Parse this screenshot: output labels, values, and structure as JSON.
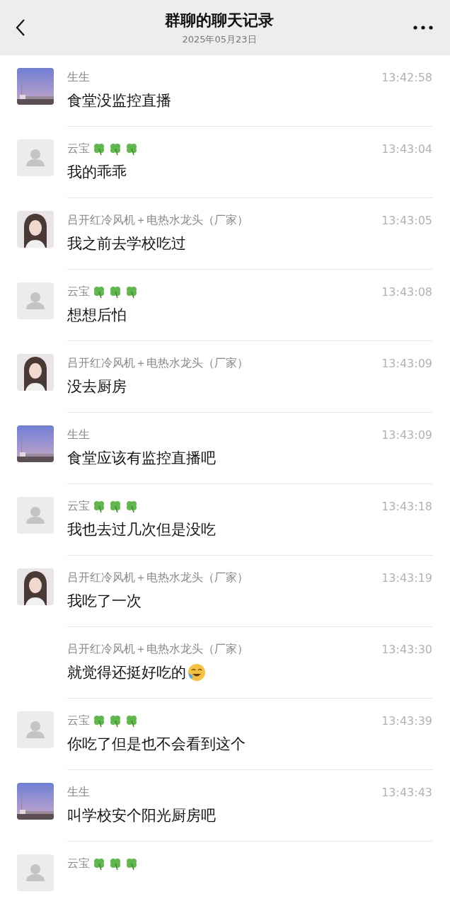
{
  "header": {
    "title": "群聊的聊天记录",
    "date": "2025年05月23日"
  },
  "messages": [
    {
      "sender": "生生",
      "time": "13:42:58",
      "text": "食堂没监控直播"
    },
    {
      "sender": "云宝",
      "name_icons": [
        {
          "kind": "clover"
        },
        {
          "kind": "clover"
        },
        {
          "kind": "clover"
        }
      ],
      "time": "13:43:04",
      "text": "我的乖乖",
      "avatar": {
        "kind": "default"
      }
    },
    {
      "sender": "吕开红冷风机＋电热水龙头（厂家）",
      "time": "13:43:05",
      "text": "我之前去学校吃过",
      "avatar": {
        "kind": "portrait"
      }
    },
    {
      "sender": "云宝",
      "name_icons": [
        {
          "kind": "clover"
        },
        {
          "kind": "clover"
        },
        {
          "kind": "clover"
        }
      ],
      "time": "13:43:08",
      "text": "想想后怕",
      "avatar": {
        "kind": "default"
      }
    },
    {
      "sender": "吕开红冷风机＋电热水龙头（厂家）",
      "time": "13:43:09",
      "text": "没去厨房",
      "avatar": {
        "kind": "portrait"
      }
    },
    {
      "sender": "生生",
      "time": "13:43:09",
      "text": "食堂应该有监控直播吧"
    },
    {
      "sender": "云宝",
      "name_icons": [
        {
          "kind": "clover"
        },
        {
          "kind": "clover"
        },
        {
          "kind": "clover"
        }
      ],
      "time": "13:43:18",
      "text": "我也去过几次但是没吃",
      "avatar": {
        "kind": "default"
      }
    },
    {
      "sender": "吕开红冷风机＋电热水龙头（厂家）",
      "time": "13:43:19",
      "text": "我吃了一次",
      "avatar": {
        "kind": "portrait"
      }
    },
    {
      "sender": "吕开红冷风机＋电热水龙头（厂家）",
      "time": "13:43:30",
      "text": "就觉得还挺好吃的",
      "trailing_icon": {
        "kind": "laugh-cry"
      }
    },
    {
      "sender": "云宝",
      "name_icons": [
        {
          "kind": "clover"
        },
        {
          "kind": "clover"
        },
        {
          "kind": "clover"
        }
      ],
      "time": "13:43:39",
      "text": "你吃了但是也不会看到这个",
      "avatar": {
        "kind": "default"
      }
    },
    {
      "sender": "生生",
      "time": "13:43:43",
      "text": "叫学校安个阳光厨房吧"
    },
    {
      "sender": "云宝",
      "name_icons": [
        {
          "kind": "clover"
        },
        {
          "kind": "clover"
        },
        {
          "kind": "clover"
        }
      ],
      "avatar": {
        "kind": "default"
      }
    }
  ]
}
